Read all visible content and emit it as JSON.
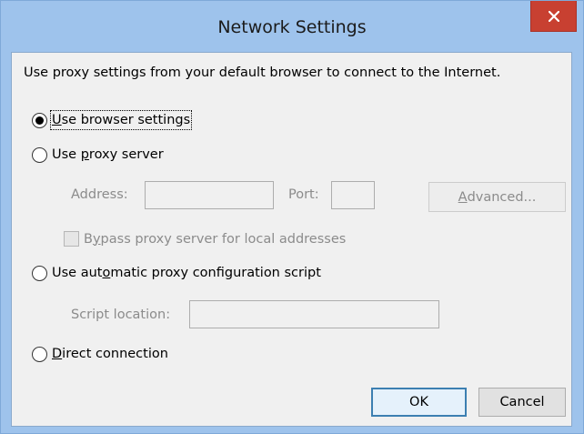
{
  "window": {
    "title": "Network Settings"
  },
  "description": "Use proxy settings from your default browser to connect to the Internet.",
  "options": {
    "browser_settings": {
      "pre": "",
      "mnemonic": "U",
      "post": "se browser settings",
      "checked": true
    },
    "proxy_server": {
      "pre": "Use ",
      "mnemonic": "p",
      "post": "roxy server",
      "checked": false
    },
    "auto_script": {
      "pre": "Use aut",
      "mnemonic": "o",
      "post": "matic proxy configuration script",
      "checked": false
    },
    "direct": {
      "pre": "",
      "mnemonic": "D",
      "post": "irect connection",
      "checked": false
    }
  },
  "proxy": {
    "address_label": "Address:",
    "address_value": "",
    "port_label": "Port:",
    "port_value": "",
    "advanced": {
      "pre": "",
      "mnemonic": "A",
      "post": "dvanced..."
    },
    "bypass": {
      "pre": "B",
      "mnemonic": "y",
      "post": "pass proxy server for local addresses",
      "checked": false
    }
  },
  "script": {
    "location_label": "Script location:",
    "location_value": ""
  },
  "buttons": {
    "ok": "OK",
    "cancel": "Cancel"
  },
  "colors": {
    "frame": "#9ec3ec",
    "close": "#c84031",
    "client": "#f0f0f0",
    "disabled_text": "#8b8b8b"
  },
  "icons": {
    "close": "close-icon"
  }
}
